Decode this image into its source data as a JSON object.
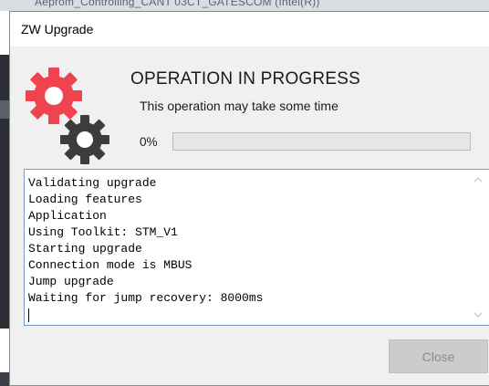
{
  "background_window": {
    "title_fragment": "Aeprom_Controlling_CANT 03CT_GATESCOM (Intel(R))"
  },
  "dialog": {
    "title": "ZW Upgrade",
    "heading": "OPERATION IN PROGRESS",
    "subheading": "This operation may take some time",
    "progress": {
      "label": "0%",
      "value": 0
    },
    "log_lines": [
      "Validating upgrade",
      "Loading features",
      "Application",
      "Using Toolkit: STM_V1",
      "Starting upgrade",
      "Connection mode is MBUS",
      "Jump upgrade",
      "Waiting for jump recovery: 8000ms"
    ],
    "close_button": {
      "label": "Close",
      "enabled": false
    },
    "icons": {
      "gears": "gears-icon",
      "scroll_up": "chevron-up-icon",
      "scroll_down": "chevron-down-icon"
    },
    "colors": {
      "gear_red": "#f0434f",
      "gear_dark": "#3c3c3c",
      "log_border": "#7a9cc4"
    }
  }
}
